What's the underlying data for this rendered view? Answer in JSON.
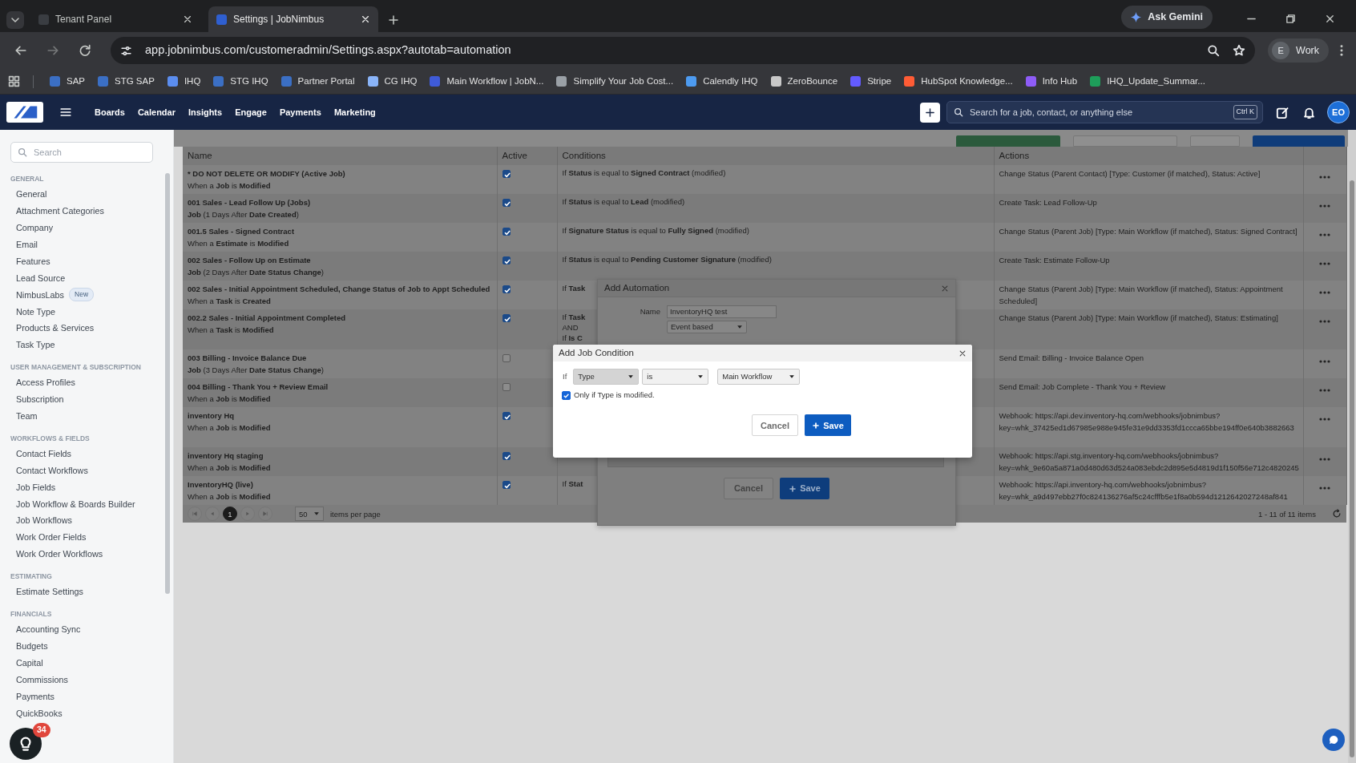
{
  "browser": {
    "tabs": [
      {
        "title": "Tenant Panel",
        "selected": false
      },
      {
        "title": "Settings | JobNimbus",
        "selected": true
      }
    ],
    "gemini": "Ask Gemini",
    "url": "app.jobnimbus.com/customeradmin/Settings.aspx?autotab=automation",
    "profile": {
      "initial": "E",
      "label": "Work"
    },
    "bookmarks": [
      {
        "label": "SAP",
        "color": "#3b6fc4"
      },
      {
        "label": "STG SAP",
        "color": "#3b6fc4"
      },
      {
        "label": "IHQ",
        "color": "#5b8def"
      },
      {
        "label": "STG IHQ",
        "color": "#3b6fc4"
      },
      {
        "label": "Partner Portal",
        "color": "#3b6fc4"
      },
      {
        "label": "CG IHQ",
        "color": "#8ab4f8"
      },
      {
        "label": "Main Workflow | JobN...",
        "color": "#3f5bd8"
      },
      {
        "label": "Simplify Your Job Cost...",
        "color": "#9aa0a6"
      },
      {
        "label": "Calendly IHQ",
        "color": "#4d9bf0"
      },
      {
        "label": "ZeroBounce",
        "color": "#c8c8c8"
      },
      {
        "label": "Stripe",
        "color": "#635bff"
      },
      {
        "label": "HubSpot Knowledge...",
        "color": "#ff5c35"
      },
      {
        "label": "Info Hub",
        "color": "#8e5cf7"
      },
      {
        "label": "IHQ_Update_Summar...",
        "color": "#1e9e5a"
      }
    ]
  },
  "navbar": {
    "menu": [
      "Boards",
      "Calendar",
      "Insights",
      "Engage",
      "Payments",
      "Marketing"
    ],
    "search_placeholder": "Search for a job, contact, or anything else",
    "shortcut": "Ctrl K",
    "avatar": "EO"
  },
  "sidebar": {
    "search_placeholder": "Search",
    "sections": [
      {
        "title": "GENERAL",
        "items": [
          {
            "label": "General"
          },
          {
            "label": "Attachment Categories"
          },
          {
            "label": "Company"
          },
          {
            "label": "Email"
          },
          {
            "label": "Features"
          },
          {
            "label": "Lead Source"
          },
          {
            "label": "NimbusLabs",
            "badge": "New"
          },
          {
            "label": "Note Type"
          },
          {
            "label": "Products & Services"
          },
          {
            "label": "Task Type"
          }
        ]
      },
      {
        "title": "USER MANAGEMENT & SUBSCRIPTION",
        "items": [
          {
            "label": "Access Profiles"
          },
          {
            "label": "Subscription"
          },
          {
            "label": "Team"
          }
        ]
      },
      {
        "title": "WORKFLOWS & FIELDS",
        "items": [
          {
            "label": "Contact Fields"
          },
          {
            "label": "Contact Workflows"
          },
          {
            "label": "Job Fields"
          },
          {
            "label": "Job Workflow & Boards Builder"
          },
          {
            "label": "Job Workflows"
          },
          {
            "label": "Work Order Fields"
          },
          {
            "label": "Work Order Workflows"
          }
        ]
      },
      {
        "title": "ESTIMATING",
        "items": [
          {
            "label": "Estimate Settings"
          }
        ]
      },
      {
        "title": "FINANCIALS",
        "items": [
          {
            "label": "Accounting Sync"
          },
          {
            "label": "Budgets"
          },
          {
            "label": "Capital"
          },
          {
            "label": "Commissions"
          },
          {
            "label": "Payments"
          },
          {
            "label": "QuickBooks"
          }
        ]
      }
    ],
    "help_badge": "34"
  },
  "table": {
    "columns": [
      "Name",
      "Active",
      "Conditions",
      "Actions"
    ],
    "rows": [
      {
        "name": "* DO NOT DELETE OR MODIFY (Active Job)",
        "trigger": "When a **Job** is **Modified**",
        "active": true,
        "conditions": [
          "If **Status** is equal to **Signed Contract** (modified)"
        ],
        "actions": [
          "Change Status (Parent Contact) [Type: Customer (if matched), Status: Active]"
        ]
      },
      {
        "name": "001 Sales - Lead Follow Up (Jobs)",
        "trigger": "**Job** (1 Days After **Date Created**)",
        "active": true,
        "conditions": [
          "If **Status** is equal to **Lead** (modified)"
        ],
        "actions": [
          "Create Task: Lead Follow-Up"
        ]
      },
      {
        "name": "001.5 Sales - Signed Contract",
        "trigger": "When a **Estimate** is **Modified**",
        "active": true,
        "conditions": [
          "If **Signature Status** is equal to **Fully Signed** (modified)"
        ],
        "actions": [
          "Change Status (Parent Job) [Type: Main Workflow (if matched), Status: Signed Contract]"
        ]
      },
      {
        "name": "002 Sales - Follow Up on Estimate",
        "trigger": "**Job** (2 Days After **Date Status Change**)",
        "active": true,
        "conditions": [
          "If **Status** is equal to **Pending Customer Signature** (modified)"
        ],
        "actions": [
          "Create Task: Estimate Follow-Up"
        ]
      },
      {
        "name": "002 Sales - Initial Appointment Scheduled, Change Status of Job to Appt Scheduled",
        "trigger": "When a **Task** is **Created**",
        "active": true,
        "conditions": [
          "If **Task**"
        ],
        "actions": [
          "Change Status (Parent Job) [Type: Main Workflow (if matched), Status: Appointment Scheduled]"
        ]
      },
      {
        "name": "002.2 Sales - Initial Appointment Completed",
        "trigger": "When a **Task** is **Modified**",
        "active": true,
        "conditions": [
          "If **Task**",
          "AND",
          "If **Is C**"
        ],
        "actions": [
          "Change Status (Parent Job) [Type: Main Workflow (if matched), Status: Estimating]"
        ]
      },
      {
        "name": "003 Billing - Invoice Balance Due",
        "trigger": "**Job** (3 Days After **Date Status Change**)",
        "active": false,
        "actions": [
          "Send Email: Billing - Invoice Balance Open"
        ]
      },
      {
        "name": "004 Billing - Thank You + Review Email",
        "trigger": "When a **Job** is **Modified**",
        "active": false,
        "actions": [
          "Send Email: Job Complete - Thank You + Review"
        ]
      },
      {
        "name": "inventory Hq",
        "trigger": "When a **Job** is **Modified**",
        "active": true,
        "actions": [
          "Webhook: https://api.dev.inventory-hq.com/webhooks/jobnimbus?",
          "key=whk_37425ed1d67985e988e945fe31e9dd3353fd1ccca65bbe194ff0e640b3882663"
        ]
      },
      {
        "name": "inventory Hq staging",
        "trigger": "When a **Job** is **Modified**",
        "active": true,
        "actions": [
          "Webhook: https://api.stg.inventory-hq.com/webhooks/jobnimbus?",
          "key=whk_9e60a5a871a0d480d63d524a083ebdc2d895e5d4819d1f150f56e712c4820245"
        ]
      },
      {
        "name": "InventoryHQ (live)",
        "trigger": "When a **Job** is **Modified**",
        "active": true,
        "conditions": [
          "If **Stat**"
        ],
        "actions": [
          "Webhook: https://api.inventory-hq.com/webhooks/jobnimbus?",
          "key=whk_a9d497ebb27f0c824136276af5c24cfffb5e1f8a0b594d1212642027248af841"
        ]
      }
    ],
    "pagination": {
      "pages": [
        {
          "label": "1",
          "selected": true
        }
      ],
      "per_page": "50",
      "per_page_label": "items per page",
      "summary": "1 - 11 of 11 items"
    }
  },
  "automation_dialog": {
    "title": "Add Automation",
    "name_label": "Name",
    "name_value": "InventoryHQ test",
    "trigger_value": "Event based",
    "cancel": "Cancel",
    "save": "Save"
  },
  "condition_dialog": {
    "title": "Add Job Condition",
    "if_label": "If",
    "field": "Type",
    "operator": "is",
    "value": "Main Workflow",
    "only_if": {
      "label": "Only if Type is modified.",
      "checked": true
    },
    "cancel": "Cancel",
    "save": "Save"
  }
}
